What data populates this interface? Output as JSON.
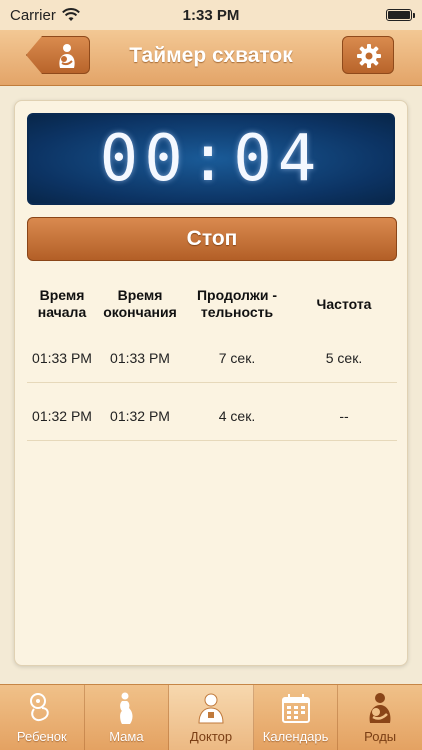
{
  "status_bar": {
    "carrier": "Carrier",
    "time": "1:33 PM"
  },
  "nav": {
    "title": "Таймер схваток"
  },
  "timer": {
    "value": "00:04"
  },
  "stop_button": {
    "label": "Стоп"
  },
  "table": {
    "headers": [
      "Время\nначала",
      "Время\nокончания",
      "Продолжи -\nтельность",
      "Частота"
    ],
    "rows": [
      [
        "01:33 PM",
        "01:33 PM",
        "7 сек.",
        "5 сек."
      ],
      [
        "01:32 PM",
        "01:32 PM",
        "4 сек.",
        "--"
      ]
    ]
  },
  "tabs": [
    {
      "label": "Ребенок",
      "icon": "baby-icon"
    },
    {
      "label": "Мама",
      "icon": "pregnant-woman-icon"
    },
    {
      "label": "Доктор",
      "icon": "doctor-icon"
    },
    {
      "label": "Календарь",
      "icon": "calendar-icon"
    },
    {
      "label": "Роды",
      "icon": "mother-child-icon"
    }
  ],
  "colors": {
    "accent": "#e3a468",
    "button": "#b8642b",
    "timer_bg": "#0c3363"
  }
}
